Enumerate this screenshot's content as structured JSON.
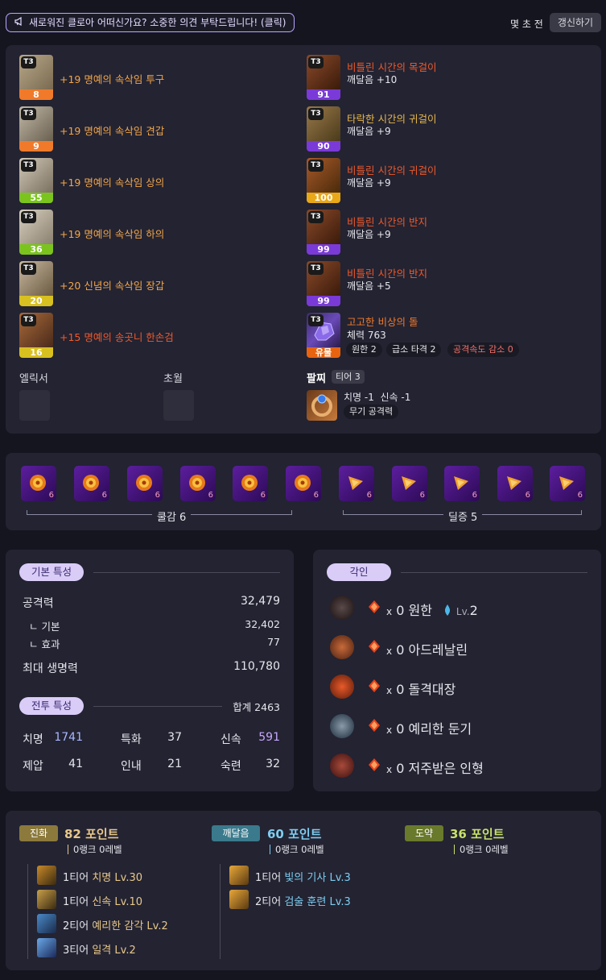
{
  "header": {
    "feedback_label": "새로워진 클로아 어떠신가요? 소중한 의견 부탁드립니다! (클릭)",
    "updated_ago": "몇 초 전",
    "refresh_label": "갱신하기"
  },
  "equipment": {
    "armor": [
      {
        "tier": "T3",
        "level": "8",
        "name": "+19 명예의 속삭임 투구",
        "bar_color": "#f07a2a"
      },
      {
        "tier": "T3",
        "level": "9",
        "name": "+19 명예의 속삭임 견갑",
        "bar_color": "#f07a2a"
      },
      {
        "tier": "T3",
        "level": "55",
        "name": "+19 명예의 속삭임 상의",
        "bar_color": "#7bc41e"
      },
      {
        "tier": "T3",
        "level": "36",
        "name": "+19 명예의 속삭임 하의",
        "bar_color": "#7bc41e"
      },
      {
        "tier": "T3",
        "level": "20",
        "name": "+20 신념의 속삭임 장갑",
        "bar_color": "#d8c020"
      },
      {
        "tier": "T3",
        "level": "16",
        "name": "+15 명예의 송곳니 한손검",
        "bar_color": "#d8c020"
      }
    ],
    "accessories": [
      {
        "tier": "T3",
        "level": "91",
        "name": "비틀린 시간의 목걸이",
        "sub": "깨달음 +10",
        "bar_color": "#7a3ad8"
      },
      {
        "tier": "T3",
        "level": "90",
        "name": "타락한 시간의 귀걸이",
        "sub": "깨달음 +9",
        "bar_color": "#7a3ad8"
      },
      {
        "tier": "T3",
        "level": "100",
        "name": "비틀린 시간의 귀걸이",
        "sub": "깨달음 +9",
        "bar_color": "#e8a818"
      },
      {
        "tier": "T3",
        "level": "99",
        "name": "비틀린 시간의 반지",
        "sub": "깨달음 +9",
        "bar_color": "#7a3ad8"
      },
      {
        "tier": "T3",
        "level": "99",
        "name": "비틀린 시간의 반지",
        "sub": "깨달음 +5",
        "bar_color": "#7a3ad8"
      }
    ],
    "stone": {
      "tier": "T3",
      "grade": "유물",
      "name": "고고한 비상의 돌",
      "sub": "체력 763",
      "engravings": [
        "원한 2",
        "급소 타격 2",
        "공격속도 감소 0"
      ]
    },
    "elixir_label": "엘릭서",
    "transcend_label": "초월",
    "bracelet": {
      "label": "팔찌",
      "tier": "티어 3",
      "line1": "치명 -1  신속 -1",
      "line2": "무기 공격력"
    }
  },
  "gems": {
    "items": [
      {
        "level": "6",
        "kind": "cooldown"
      },
      {
        "level": "6",
        "kind": "cooldown"
      },
      {
        "level": "6",
        "kind": "cooldown"
      },
      {
        "level": "6",
        "kind": "cooldown"
      },
      {
        "level": "6",
        "kind": "cooldown"
      },
      {
        "level": "6",
        "kind": "cooldown"
      },
      {
        "level": "6",
        "kind": "damage"
      },
      {
        "level": "6",
        "kind": "damage"
      },
      {
        "level": "6",
        "kind": "damage"
      },
      {
        "level": "6",
        "kind": "damage"
      },
      {
        "level": "6",
        "kind": "damage"
      }
    ],
    "cooldown_summary": "쿨감 6",
    "damage_summary": "딜증 5"
  },
  "basic_stats": {
    "title": "기본 특성",
    "attack_label": "공격력",
    "attack_value": "32,479",
    "base_label": "ㄴ 기본",
    "base_value": "32,402",
    "effect_label": "ㄴ 효과",
    "effect_value": "77",
    "hp_label": "최대 생명력",
    "hp_value": "110,780"
  },
  "combat_stats": {
    "title": "전투 특성",
    "total": "합계 2463",
    "stats": [
      {
        "label": "치명",
        "value": "1741",
        "color": "#a9b8ff"
      },
      {
        "label": "특화",
        "value": "37",
        "color": "#e6e6ec"
      },
      {
        "label": "신속",
        "value": "591",
        "color": "#c8a8ff"
      },
      {
        "label": "제압",
        "value": "41",
        "color": "#e6e6ec"
      },
      {
        "label": "인내",
        "value": "21",
        "color": "#e6e6ec"
      },
      {
        "label": "숙련",
        "value": "32",
        "color": "#e6e6ec"
      }
    ]
  },
  "engravings": {
    "title": "각인",
    "items": [
      {
        "count": "x",
        "text": "0 원한",
        "extra": "Lv.",
        "extra_num": "2"
      },
      {
        "count": "x",
        "text": "0 아드레날린"
      },
      {
        "count": "x",
        "text": "0 돌격대장"
      },
      {
        "count": "x",
        "text": "0 예리한 둔기"
      },
      {
        "count": "x",
        "text": "0 저주받은 인형"
      }
    ]
  },
  "ark_passive": {
    "evolution": {
      "tag": "진화",
      "points": "82 포인트",
      "rank": "0랭크 0레벨",
      "color": "#e8c88a",
      "tag_color": "#8c7a3c"
    },
    "enlightenment": {
      "tag": "깨달음",
      "points": "60 포인트",
      "rank": "0랭크 0레벨",
      "color": "#7ecdf0",
      "tag_color": "#3a7a8c"
    },
    "leap": {
      "tag": "도약",
      "points": "36 포인트",
      "rank": "0랭크 0레벨",
      "color": "#c8e06a",
      "tag_color": "#6a7a2c"
    },
    "evolution_nodes": [
      {
        "tier": "1티어",
        "name": "치명 Lv.30"
      },
      {
        "tier": "1티어",
        "name": "신속 Lv.10"
      },
      {
        "tier": "2티어",
        "name": "예리한 감각 Lv.2"
      },
      {
        "tier": "3티어",
        "name": "일격 Lv.2"
      }
    ],
    "enlightenment_nodes": [
      {
        "tier": "1티어",
        "name": "빛의 기사 Lv.3"
      },
      {
        "tier": "2티어",
        "name": "검술 훈련 Lv.3"
      }
    ]
  }
}
